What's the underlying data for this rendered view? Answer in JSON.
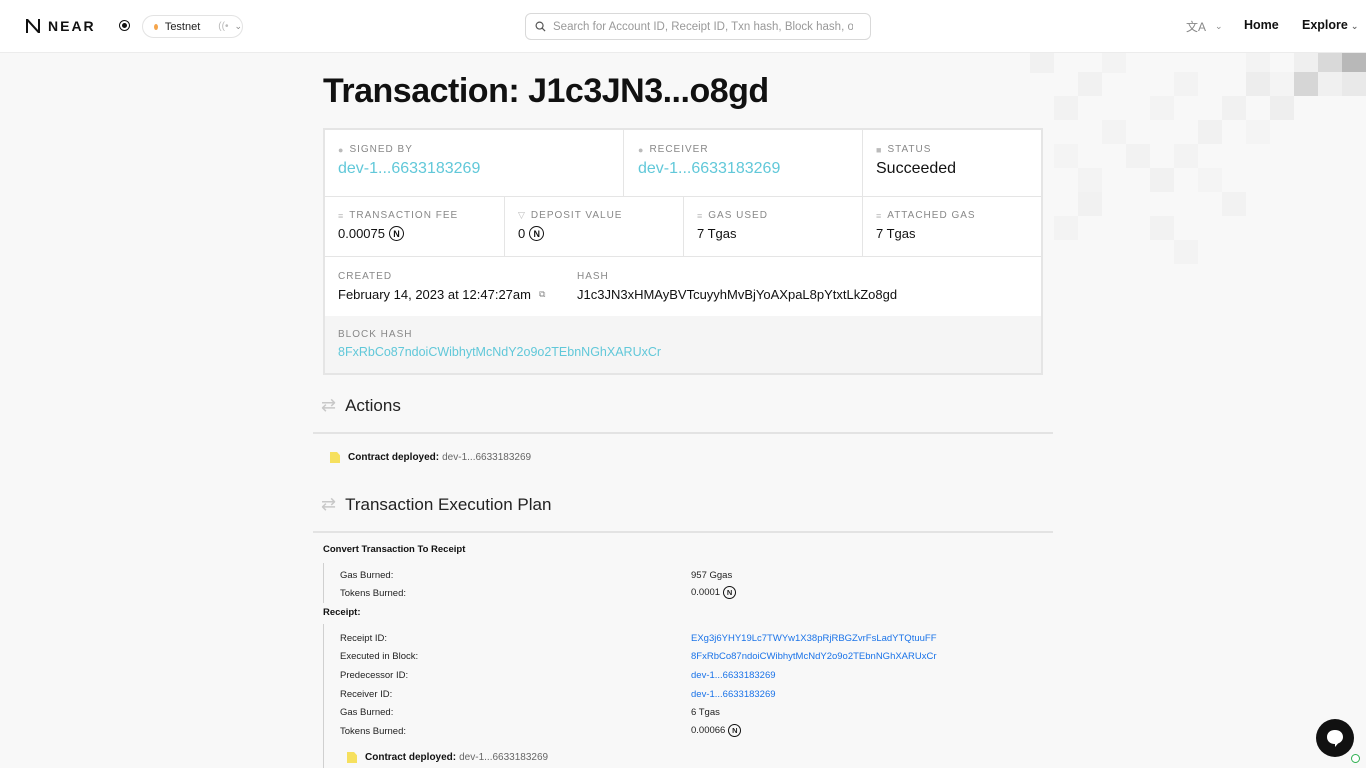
{
  "header": {
    "logo_text": "NEAR",
    "network": "Testnet",
    "search_placeholder": "Search for Account ID, Receipt ID, Txn hash, Block hash, or Block height",
    "lang_icon": "translate-icon",
    "nav_home": "Home",
    "nav_explore": "Explore"
  },
  "title": "Transaction: J1c3JN3...o8gd",
  "tx": {
    "signed_by_label": "SIGNED BY",
    "signed_by": "dev-1...6633183269",
    "receiver_label": "RECEIVER",
    "receiver": "dev-1...6633183269",
    "status_label": "STATUS",
    "status": "Succeeded",
    "fee_label": "TRANSACTION FEE",
    "fee": "0.00075",
    "deposit_label": "DEPOSIT VALUE",
    "deposit": "0",
    "gas_used_label": "GAS USED",
    "gas_used": "7 Tgas",
    "attached_gas_label": "ATTACHED GAS",
    "attached_gas": "7 Tgas",
    "created_label": "CREATED",
    "created": "February 14, 2023 at 12:47:27am",
    "hash_label": "HASH",
    "hash": "J1c3JN3xHMAyBVTcuyyhMvBjYoAXpaL8pYtxtLkZo8gd",
    "block_hash_label": "BLOCK HASH",
    "block_hash": "8FxRbCo87ndoiCWibhytMcNdY2o9o2TEbnNGhXARUxCr"
  },
  "actions": {
    "heading": "Actions",
    "items": [
      {
        "label": "Contract deployed:",
        "target": "dev-1...6633183269"
      }
    ]
  },
  "plan": {
    "heading": "Transaction Execution Plan",
    "convert_label": "Convert Transaction To Receipt",
    "gas_burned_key": "Gas Burned:",
    "gas_burned": "957 Ggas",
    "tokens_burned_key": "Tokens Burned:",
    "tokens_burned": "0.0001",
    "receipt_label": "Receipt:",
    "receipt": {
      "id_key": "Receipt ID:",
      "id": "EXg3j6YHY19Lc7TWYw1X38pRjRBGZvrFsLadYTQtuuFF",
      "block_key": "Executed in Block:",
      "block": "8FxRbCo87ndoiCWibhytMcNdY2o9o2TEbnNGhXARUxCr",
      "predecessor_key": "Predecessor ID:",
      "predecessor": "dev-1...6633183269",
      "receiver_key": "Receiver ID:",
      "receiver": "dev-1...6633183269",
      "gas_burned_key": "Gas Burned:",
      "gas_burned": "6 Tgas",
      "tokens_burned_key": "Tokens Burned:",
      "tokens_burned": "0.00066",
      "action_label": "Contract deployed:",
      "action_target": "dev-1...6633183269"
    }
  },
  "coin_symbol": "N"
}
